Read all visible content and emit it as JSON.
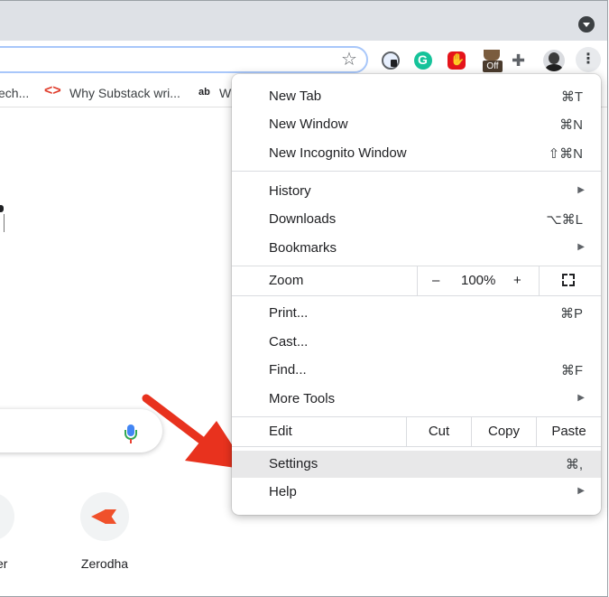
{
  "toolbar": {
    "extensions": [
      "password-manager-icon",
      "grammarly-icon",
      "adblock-icon",
      "coffee-icon",
      "puzzle-icon"
    ],
    "extension_badge": "Off"
  },
  "bookmarks": {
    "items": [
      "ech...",
      "Why Substack wri...",
      "W"
    ],
    "third_icon_text": "ab"
  },
  "ntp": {
    "shortcuts": [
      "er",
      "Zerodha"
    ]
  },
  "menu": {
    "group1": [
      {
        "label": "New Tab",
        "shortcut": "⌘T"
      },
      {
        "label": "New Window",
        "shortcut": "⌘N"
      },
      {
        "label": "New Incognito Window",
        "shortcut": "⇧⌘N"
      }
    ],
    "group2": [
      {
        "label": "History",
        "submenu": true
      },
      {
        "label": "Downloads",
        "shortcut": "⌥⌘L"
      },
      {
        "label": "Bookmarks",
        "submenu": true
      }
    ],
    "zoom": {
      "label": "Zoom",
      "minus": "–",
      "level": "100%",
      "plus": "+"
    },
    "group3": [
      {
        "label": "Print...",
        "shortcut": "⌘P"
      },
      {
        "label": "Cast..."
      },
      {
        "label": "Find...",
        "shortcut": "⌘F"
      },
      {
        "label": "More Tools",
        "submenu": true
      }
    ],
    "edit": {
      "label": "Edit",
      "cut": "Cut",
      "copy": "Copy",
      "paste": "Paste"
    },
    "group4": [
      {
        "label": "Settings",
        "shortcut": "⌘,",
        "highlighted": true
      },
      {
        "label": "Help",
        "submenu": true
      }
    ]
  },
  "colors": {
    "arrow": "#e8321e",
    "highlight": "#e8e8e9",
    "tabstrip": "#dee1e6"
  }
}
